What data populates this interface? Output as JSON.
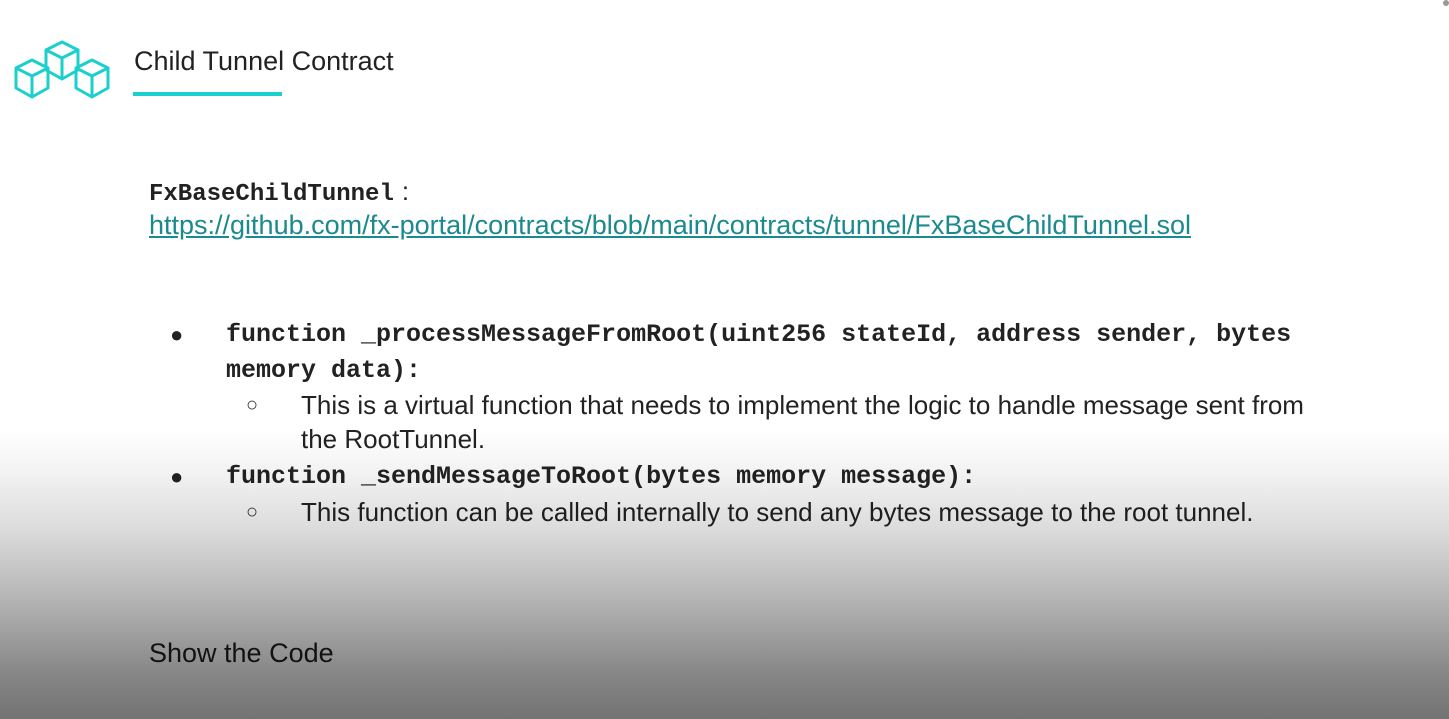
{
  "header": {
    "title": "Child Tunnel Contract",
    "logo_icon": "cubes-logo-icon",
    "accent_color": "#1ccfcf"
  },
  "contract": {
    "name": "FxBaseChildTunnel",
    "separator": ":",
    "link_text": "https://github.com/fx-portal/contracts/blob/main/contracts/tunnel/FxBaseChildTunnel.sol",
    "link_color": "#1a8a8f"
  },
  "bullets": [
    {
      "signature": "function _processMessageFromRoot(uint256 stateId, address sender, bytes memory data):",
      "description": "This is a virtual function that needs to implement the logic to handle message sent from the RootTunnel."
    },
    {
      "signature": "function _sendMessageToRoot(bytes memory message):",
      "description": "This function can be called internally to send any bytes message to the root tunnel."
    }
  ],
  "footer": {
    "text": "Show the Code"
  }
}
